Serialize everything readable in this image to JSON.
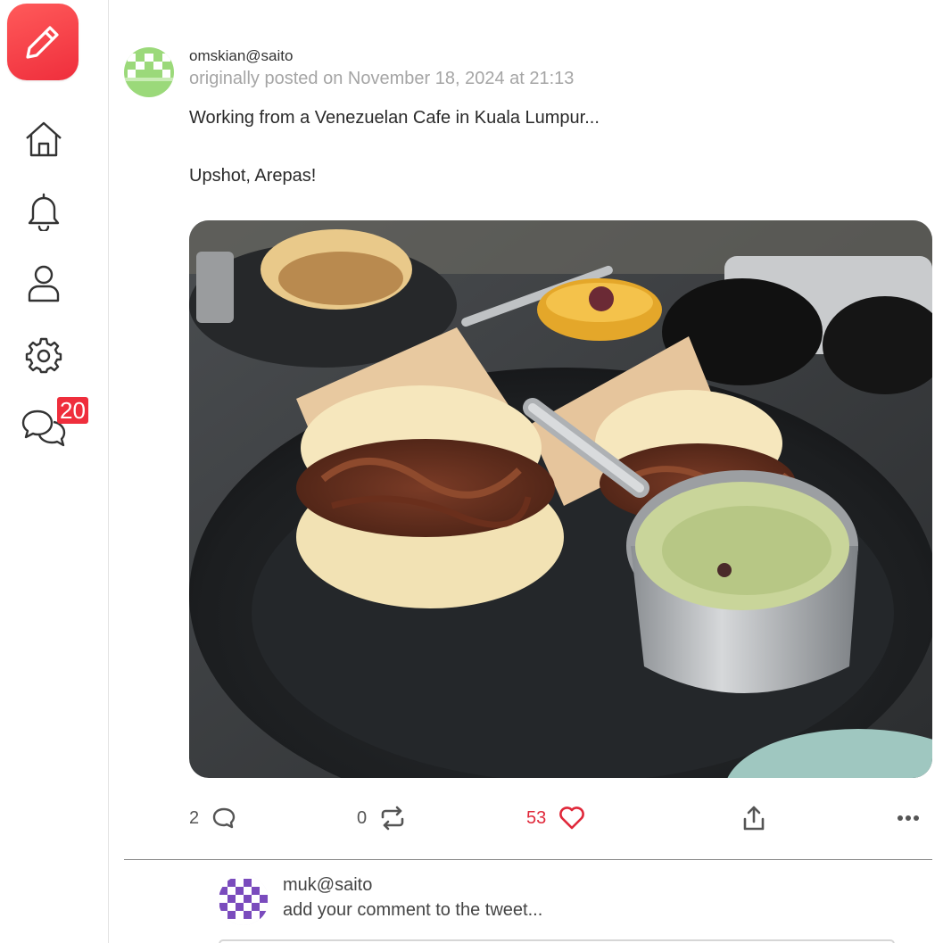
{
  "sidebar": {
    "compose_icon": "pencil-icon",
    "items": [
      {
        "name": "home",
        "icon": "home-icon"
      },
      {
        "name": "notifications",
        "icon": "bell-icon"
      },
      {
        "name": "profile",
        "icon": "user-icon"
      },
      {
        "name": "settings",
        "icon": "gear-icon"
      },
      {
        "name": "chat",
        "icon": "chat-bubbles-icon",
        "badge": "20"
      }
    ]
  },
  "post": {
    "author": "omskian@saito",
    "meta_prefix": "originally posted on",
    "date": "November 18, 2024 at 21:13",
    "text_line1": "Working from a Venezuelan Cafe in Kuala Lumpur...",
    "text_line2": "Upshot, Arepas!",
    "image_description_icon": "photo-arepas",
    "actions": {
      "comments": "2",
      "retweets": "0",
      "likes": "53"
    }
  },
  "reply": {
    "author": "muk@saito",
    "placeholder": "add your comment to the tweet..."
  },
  "colors": {
    "accent": "#ef2e3c",
    "muted_text": "#a5a5a5",
    "avatar_green": "#9bd97a",
    "avatar_purple": "#7a4bbd"
  }
}
